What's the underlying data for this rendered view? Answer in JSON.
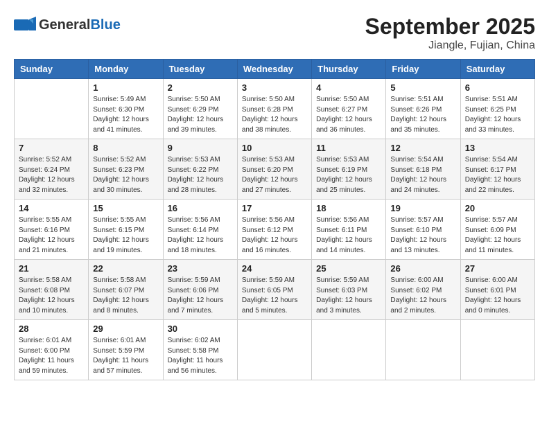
{
  "header": {
    "logo_general": "General",
    "logo_blue": "Blue",
    "title": "September 2025",
    "subtitle": "Jiangle, Fujian, China"
  },
  "days_of_week": [
    "Sunday",
    "Monday",
    "Tuesday",
    "Wednesday",
    "Thursday",
    "Friday",
    "Saturday"
  ],
  "weeks": [
    [
      {
        "day": "",
        "info": ""
      },
      {
        "day": "1",
        "info": "Sunrise: 5:49 AM\nSunset: 6:30 PM\nDaylight: 12 hours\nand 41 minutes."
      },
      {
        "day": "2",
        "info": "Sunrise: 5:50 AM\nSunset: 6:29 PM\nDaylight: 12 hours\nand 39 minutes."
      },
      {
        "day": "3",
        "info": "Sunrise: 5:50 AM\nSunset: 6:28 PM\nDaylight: 12 hours\nand 38 minutes."
      },
      {
        "day": "4",
        "info": "Sunrise: 5:50 AM\nSunset: 6:27 PM\nDaylight: 12 hours\nand 36 minutes."
      },
      {
        "day": "5",
        "info": "Sunrise: 5:51 AM\nSunset: 6:26 PM\nDaylight: 12 hours\nand 35 minutes."
      },
      {
        "day": "6",
        "info": "Sunrise: 5:51 AM\nSunset: 6:25 PM\nDaylight: 12 hours\nand 33 minutes."
      }
    ],
    [
      {
        "day": "7",
        "info": "Sunrise: 5:52 AM\nSunset: 6:24 PM\nDaylight: 12 hours\nand 32 minutes."
      },
      {
        "day": "8",
        "info": "Sunrise: 5:52 AM\nSunset: 6:23 PM\nDaylight: 12 hours\nand 30 minutes."
      },
      {
        "day": "9",
        "info": "Sunrise: 5:53 AM\nSunset: 6:22 PM\nDaylight: 12 hours\nand 28 minutes."
      },
      {
        "day": "10",
        "info": "Sunrise: 5:53 AM\nSunset: 6:20 PM\nDaylight: 12 hours\nand 27 minutes."
      },
      {
        "day": "11",
        "info": "Sunrise: 5:53 AM\nSunset: 6:19 PM\nDaylight: 12 hours\nand 25 minutes."
      },
      {
        "day": "12",
        "info": "Sunrise: 5:54 AM\nSunset: 6:18 PM\nDaylight: 12 hours\nand 24 minutes."
      },
      {
        "day": "13",
        "info": "Sunrise: 5:54 AM\nSunset: 6:17 PM\nDaylight: 12 hours\nand 22 minutes."
      }
    ],
    [
      {
        "day": "14",
        "info": "Sunrise: 5:55 AM\nSunset: 6:16 PM\nDaylight: 12 hours\nand 21 minutes."
      },
      {
        "day": "15",
        "info": "Sunrise: 5:55 AM\nSunset: 6:15 PM\nDaylight: 12 hours\nand 19 minutes."
      },
      {
        "day": "16",
        "info": "Sunrise: 5:56 AM\nSunset: 6:14 PM\nDaylight: 12 hours\nand 18 minutes."
      },
      {
        "day": "17",
        "info": "Sunrise: 5:56 AM\nSunset: 6:12 PM\nDaylight: 12 hours\nand 16 minutes."
      },
      {
        "day": "18",
        "info": "Sunrise: 5:56 AM\nSunset: 6:11 PM\nDaylight: 12 hours\nand 14 minutes."
      },
      {
        "day": "19",
        "info": "Sunrise: 5:57 AM\nSunset: 6:10 PM\nDaylight: 12 hours\nand 13 minutes."
      },
      {
        "day": "20",
        "info": "Sunrise: 5:57 AM\nSunset: 6:09 PM\nDaylight: 12 hours\nand 11 minutes."
      }
    ],
    [
      {
        "day": "21",
        "info": "Sunrise: 5:58 AM\nSunset: 6:08 PM\nDaylight: 12 hours\nand 10 minutes."
      },
      {
        "day": "22",
        "info": "Sunrise: 5:58 AM\nSunset: 6:07 PM\nDaylight: 12 hours\nand 8 minutes."
      },
      {
        "day": "23",
        "info": "Sunrise: 5:59 AM\nSunset: 6:06 PM\nDaylight: 12 hours\nand 7 minutes."
      },
      {
        "day": "24",
        "info": "Sunrise: 5:59 AM\nSunset: 6:05 PM\nDaylight: 12 hours\nand 5 minutes."
      },
      {
        "day": "25",
        "info": "Sunrise: 5:59 AM\nSunset: 6:03 PM\nDaylight: 12 hours\nand 3 minutes."
      },
      {
        "day": "26",
        "info": "Sunrise: 6:00 AM\nSunset: 6:02 PM\nDaylight: 12 hours\nand 2 minutes."
      },
      {
        "day": "27",
        "info": "Sunrise: 6:00 AM\nSunset: 6:01 PM\nDaylight: 12 hours\nand 0 minutes."
      }
    ],
    [
      {
        "day": "28",
        "info": "Sunrise: 6:01 AM\nSunset: 6:00 PM\nDaylight: 11 hours\nand 59 minutes."
      },
      {
        "day": "29",
        "info": "Sunrise: 6:01 AM\nSunset: 5:59 PM\nDaylight: 11 hours\nand 57 minutes."
      },
      {
        "day": "30",
        "info": "Sunrise: 6:02 AM\nSunset: 5:58 PM\nDaylight: 11 hours\nand 56 minutes."
      },
      {
        "day": "",
        "info": ""
      },
      {
        "day": "",
        "info": ""
      },
      {
        "day": "",
        "info": ""
      },
      {
        "day": "",
        "info": ""
      }
    ]
  ]
}
